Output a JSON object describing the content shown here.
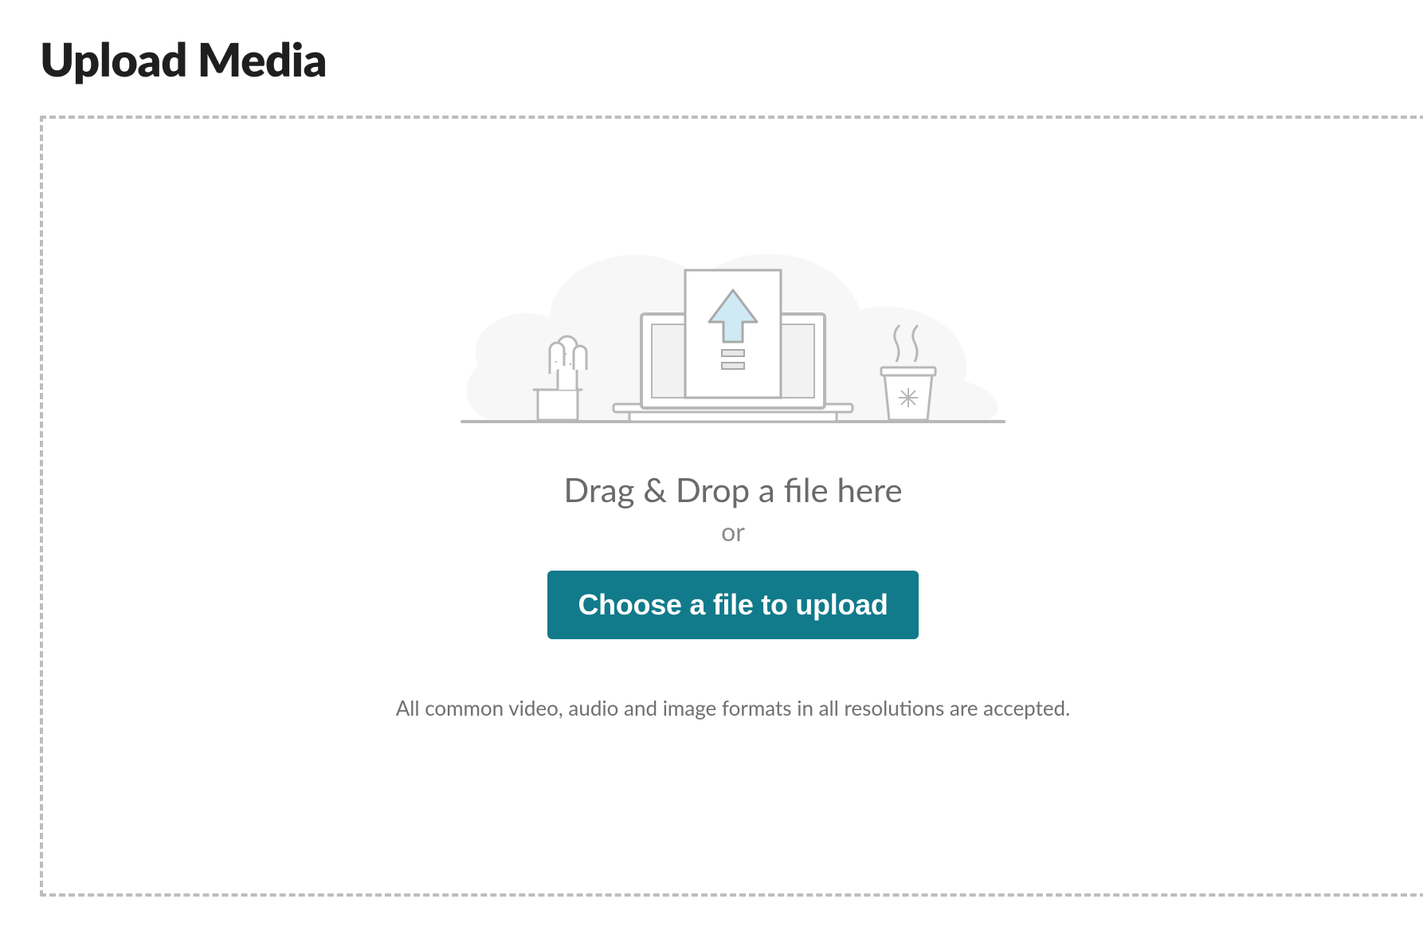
{
  "header": {
    "title": "Upload Media"
  },
  "dropzone": {
    "drag_drop_text": "Drag & Drop a file here",
    "or_text": "or",
    "choose_button_label": "Choose a file to upload",
    "helper_text": "All common video, audio and image formats in all resolutions are accepted."
  },
  "colors": {
    "button_bg": "#117a8b",
    "border_dashed": "#bdbdbd",
    "text_muted": "#6a6a6a"
  }
}
